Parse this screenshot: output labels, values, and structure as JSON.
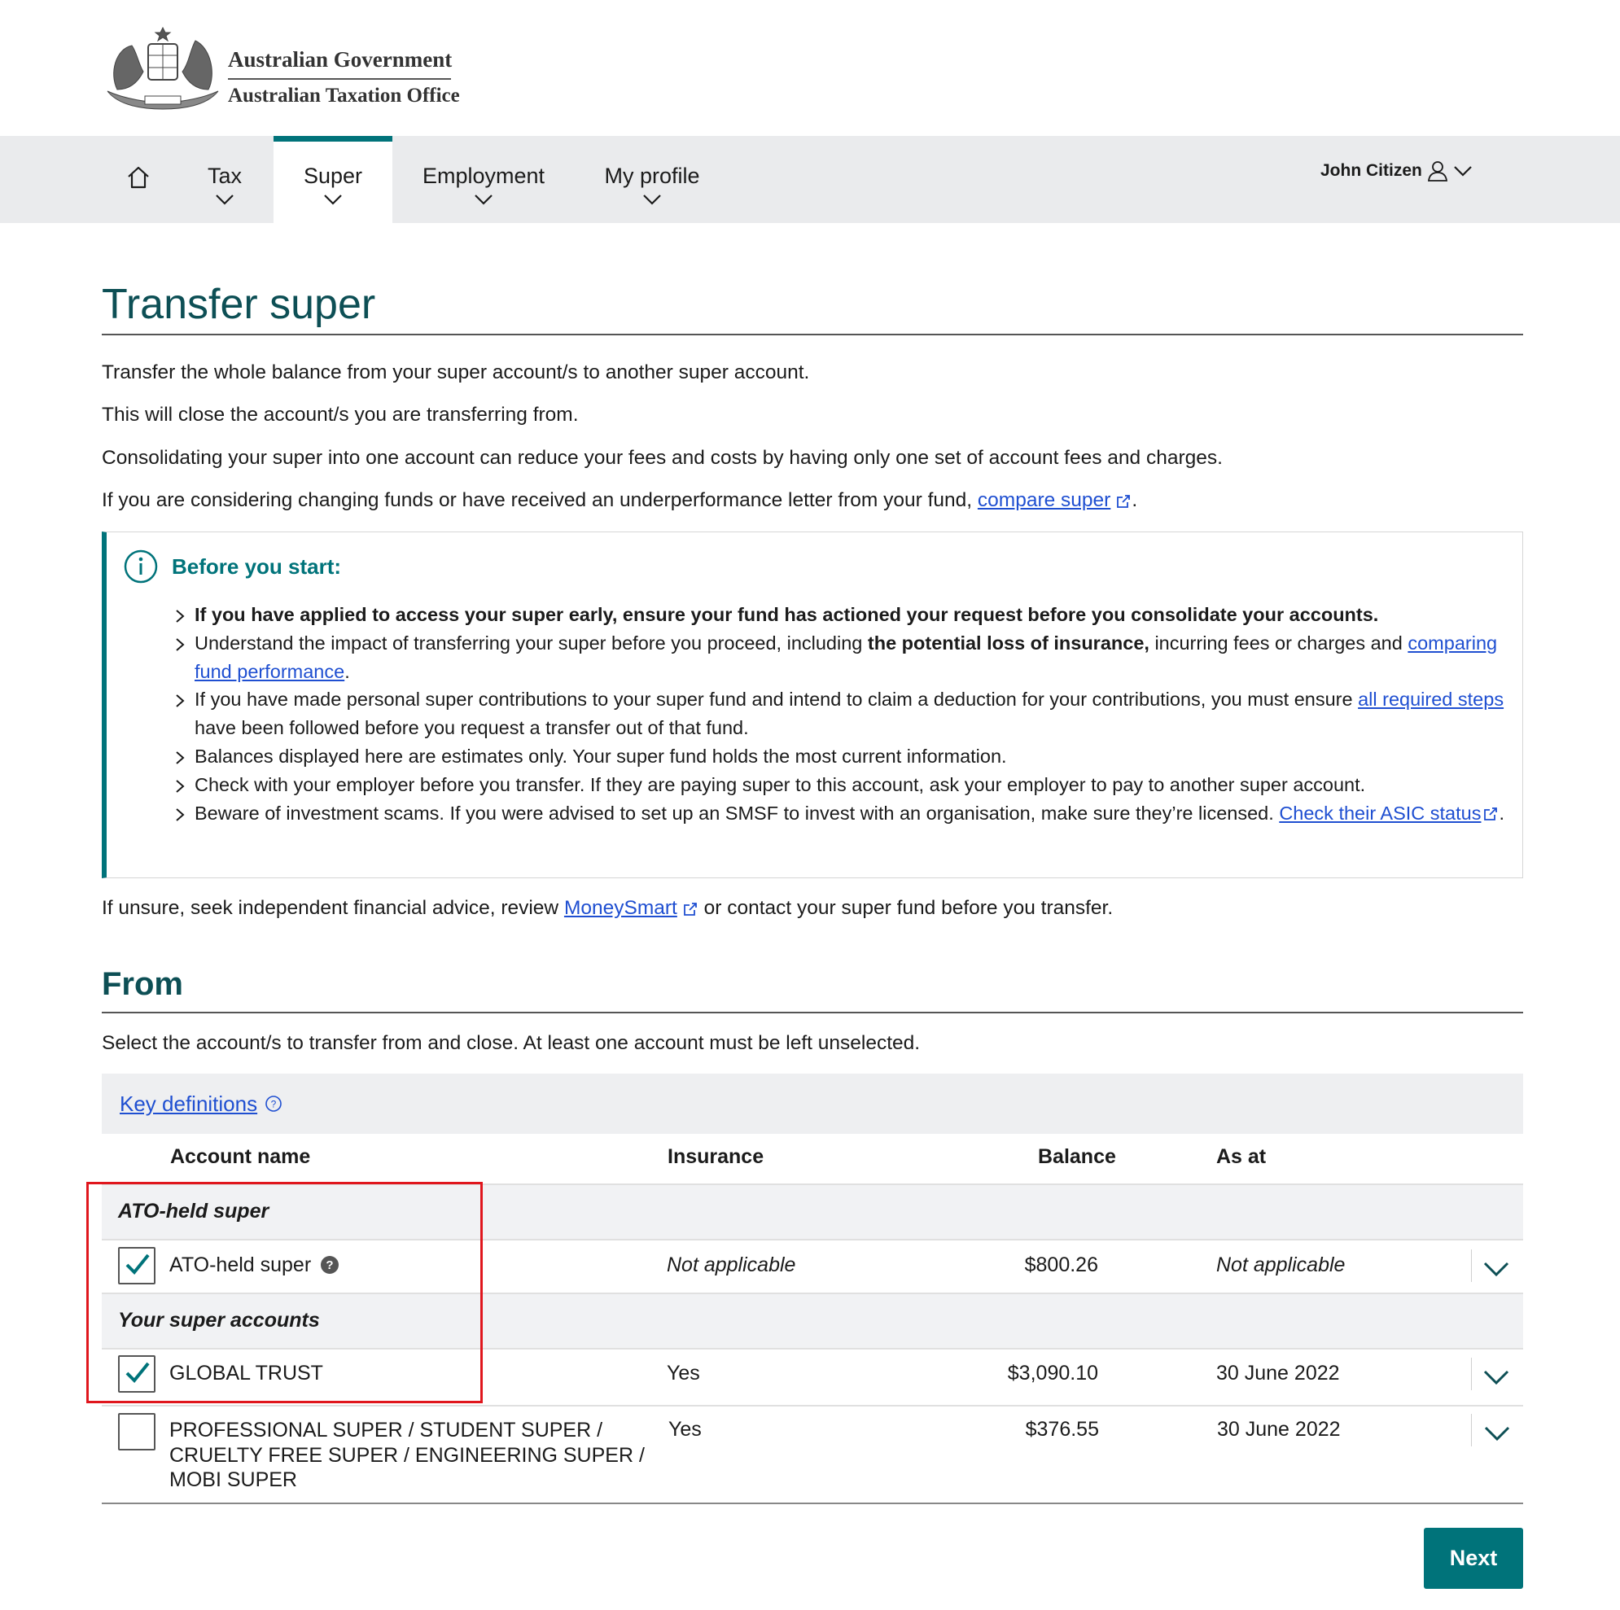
{
  "header": {
    "gov_line1": "Australian Government",
    "gov_line2": "Australian Taxation Office"
  },
  "nav": {
    "items": [
      {
        "label": "Tax"
      },
      {
        "label": "Super"
      },
      {
        "label": "Employment"
      },
      {
        "label": "My profile"
      }
    ],
    "user_name": "John Citizen"
  },
  "page": {
    "title": "Transfer super",
    "intro1": "Transfer the whole balance from your super account/s to another super account.",
    "intro2": "This will close the account/s you are transferring from.",
    "intro3": "Consolidating your super into one account can reduce your fees and costs by having only one set of account fees and charges.",
    "intro4_pre": "If you are considering changing funds or have received an underperformance letter from your fund, ",
    "intro4_link": "compare super",
    "intro4_post": "."
  },
  "info": {
    "title": "Before you start:",
    "b1": "If you have applied to access your super early, ensure your fund has actioned your request before you consolidate your accounts.",
    "b2_pre": "Understand the impact of transferring your super before you proceed, including ",
    "b2_bold": "the potential loss of insurance,",
    "b2_post": " incurring fees or charges and ",
    "b2_link": "comparing fund performance",
    "b2_end": ".",
    "b3_pre": "If you have made personal super contributions to your super fund and intend to claim a deduction for your contributions, you must ensure ",
    "b3_link": "all required steps",
    "b3_post": " have been followed before you request a transfer out of that fund.",
    "b4": "Balances displayed here are estimates only. Your super fund holds the most current information.",
    "b5": "Check with your employer before you transfer. If they are paying super to this account, ask your employer to pay to another super account.",
    "b6_pre": "Beware of investment scams. If you were advised to set up an SMSF to invest with an organisation, make sure they’re licensed. ",
    "b6_link": "Check their ASIC status",
    "b6_end": "."
  },
  "advice": {
    "pre": "If unsure, seek independent financial advice, review ",
    "link": "MoneySmart",
    "post": " or contact your super fund before you transfer."
  },
  "from": {
    "title": "From",
    "instruction": "Select the account/s to transfer from and close. At least one account must be left unselected.",
    "key_definitions": "Key definitions"
  },
  "table": {
    "headers": {
      "account": "Account name",
      "insurance": "Insurance",
      "balance": "Balance",
      "as_at": "As at"
    },
    "group1": "ATO-held super",
    "group2": "Your super accounts",
    "rows": [
      {
        "name": "ATO-held super",
        "insurance": "Not applicable",
        "balance": "$800.26",
        "as_at": "Not applicable",
        "checked": true
      },
      {
        "name": "GLOBAL TRUST",
        "insurance": "Yes",
        "balance": "$3,090.10",
        "as_at": "30 June 2022",
        "checked": true
      },
      {
        "name_l1": "PROFESSIONAL SUPER / STUDENT SUPER /",
        "name_l2": "CRUELTY FREE SUPER / ENGINEERING SUPER /",
        "name_l3": "MOBI SUPER",
        "insurance": "Yes",
        "balance": "$376.55",
        "as_at": "30 June 2022",
        "checked": false
      }
    ]
  },
  "actions": {
    "next": "Next"
  },
  "colors": {
    "teal": "#00737a",
    "title": "#0d4f55",
    "link": "#1f4fd1",
    "highlight": "#e0161d"
  }
}
